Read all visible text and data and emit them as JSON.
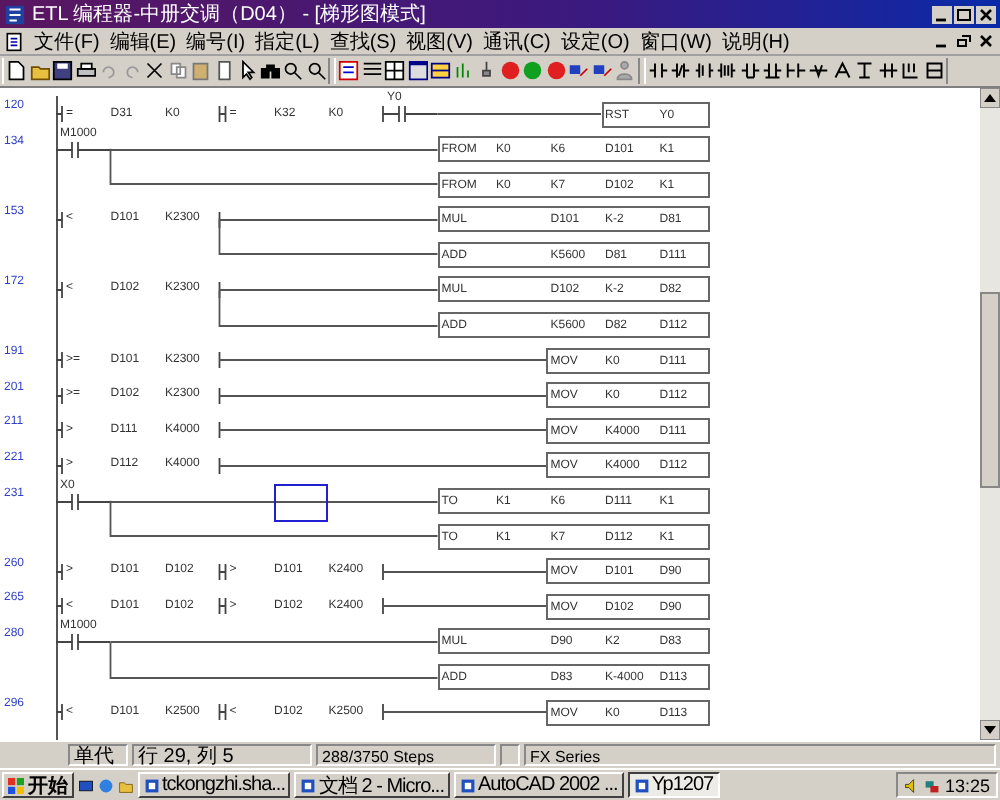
{
  "window": {
    "title": "ETL 编程器-中册交调（D04） - [梯形图模式]"
  },
  "menu": [
    "文件(F)",
    "编辑(E)",
    "编号(I)",
    "指定(L)",
    "查找(S)",
    "视图(V)",
    "通讯(C)",
    "设定(O)",
    "窗口(W)",
    "说明(H)"
  ],
  "ladder": {
    "rows": [
      {
        "kind": "rung",
        "step": "120",
        "cursor": false,
        "elements": [
          {
            "kind": "compare",
            "op": "=",
            "a": "D31",
            "b": "K0"
          },
          {
            "kind": "compare",
            "op": "=",
            "a": "K32",
            "b": "K0"
          },
          {
            "kind": "contact",
            "device": "Y0"
          }
        ],
        "output": {
          "op": "RST",
          "operands": [
            "Y0"
          ]
        }
      },
      {
        "kind": "rung",
        "step": "134",
        "cursor": false,
        "elements": [
          {
            "kind": "contact",
            "device": "M1000"
          }
        ],
        "output": {
          "op": "FROM",
          "operands": [
            "K0",
            "K6",
            "D101",
            "K1"
          ]
        }
      },
      {
        "kind": "branch",
        "cursor": false,
        "output": {
          "op": "FROM",
          "operands": [
            "K0",
            "K7",
            "D102",
            "K1"
          ]
        }
      },
      {
        "kind": "rung",
        "step": "153",
        "cursor": false,
        "elements": [
          {
            "kind": "compare",
            "op": "<",
            "a": "D101",
            "b": "K2300"
          }
        ],
        "output": {
          "op": "MUL",
          "operands": [
            "D101",
            "K-2",
            "D81"
          ]
        }
      },
      {
        "kind": "branch",
        "cursor": false,
        "output": {
          "op": "ADD",
          "operands": [
            "K5600",
            "D81",
            "D111"
          ]
        }
      },
      {
        "kind": "rung",
        "step": "172",
        "cursor": false,
        "elements": [
          {
            "kind": "compare",
            "op": "<",
            "a": "D102",
            "b": "K2300"
          }
        ],
        "output": {
          "op": "MUL",
          "operands": [
            "D102",
            "K-2",
            "D82"
          ]
        }
      },
      {
        "kind": "branch",
        "cursor": false,
        "output": {
          "op": "ADD",
          "operands": [
            "K5600",
            "D82",
            "D112"
          ]
        }
      },
      {
        "kind": "rung",
        "step": "191",
        "cursor": false,
        "elements": [
          {
            "kind": "compare",
            "op": ">=",
            "a": "D101",
            "b": "K2300"
          }
        ],
        "output": {
          "op": "MOV",
          "operands": [
            "K0",
            "D111"
          ]
        }
      },
      {
        "kind": "rung",
        "step": "201",
        "cursor": false,
        "elements": [
          {
            "kind": "compare",
            "op": ">=",
            "a": "D102",
            "b": "K2300"
          }
        ],
        "output": {
          "op": "MOV",
          "operands": [
            "K0",
            "D112"
          ]
        }
      },
      {
        "kind": "rung",
        "step": "211",
        "cursor": false,
        "elements": [
          {
            "kind": "compare",
            "op": ">",
            "a": "D111",
            "b": "K4000"
          }
        ],
        "output": {
          "op": "MOV",
          "operands": [
            "K4000",
            "D111"
          ]
        }
      },
      {
        "kind": "rung",
        "step": "221",
        "cursor": false,
        "elements": [
          {
            "kind": "compare",
            "op": ">",
            "a": "D112",
            "b": "K4000"
          }
        ],
        "output": {
          "op": "MOV",
          "operands": [
            "K4000",
            "D112"
          ]
        }
      },
      {
        "kind": "rung",
        "step": "231",
        "cursor": true,
        "elements": [
          {
            "kind": "contact",
            "device": "X0"
          }
        ],
        "output": {
          "op": "TO",
          "operands": [
            "K1",
            "K6",
            "D111",
            "K1"
          ]
        }
      },
      {
        "kind": "branch",
        "cursor": false,
        "output": {
          "op": "TO",
          "operands": [
            "K1",
            "K7",
            "D112",
            "K1"
          ]
        }
      },
      {
        "kind": "rung",
        "step": "260",
        "cursor": false,
        "elements": [
          {
            "kind": "compare",
            "op": ">",
            "a": "D101",
            "b": "D102"
          },
          {
            "kind": "compare",
            "op": ">",
            "a": "D101",
            "b": "K2400"
          }
        ],
        "output": {
          "op": "MOV",
          "operands": [
            "D101",
            "D90"
          ]
        }
      },
      {
        "kind": "rung",
        "step": "265",
        "cursor": false,
        "elements": [
          {
            "kind": "compare",
            "op": "<",
            "a": "D101",
            "b": "D102"
          },
          {
            "kind": "compare",
            "op": ">",
            "a": "D102",
            "b": "K2400"
          }
        ],
        "output": {
          "op": "MOV",
          "operands": [
            "D102",
            "D90"
          ]
        }
      },
      {
        "kind": "rung",
        "step": "280",
        "cursor": false,
        "elements": [
          {
            "kind": "contact",
            "device": "M1000"
          }
        ],
        "output": {
          "op": "MUL",
          "operands": [
            "D90",
            "K2",
            "D83"
          ]
        }
      },
      {
        "kind": "branch",
        "cursor": false,
        "output": {
          "op": "ADD",
          "operands": [
            "D83",
            "K-4000",
            "D113"
          ]
        }
      },
      {
        "kind": "rung",
        "step": "296",
        "cursor": false,
        "elements": [
          {
            "kind": "compare",
            "op": "<",
            "a": "D101",
            "b": "K2500"
          },
          {
            "kind": "compare",
            "op": "<",
            "a": "D102",
            "b": "K2500"
          }
        ],
        "output": {
          "op": "MOV",
          "operands": [
            "K0",
            "D113"
          ]
        }
      }
    ]
  },
  "status_bar": {
    "mode": "单代",
    "position": "行 29, 列 5",
    "steps": "288/3750 Steps",
    "series": "FX Series"
  },
  "taskbar": {
    "start": "开始",
    "tasks": [
      {
        "label": "tckongzhi.sha...",
        "selected": false
      },
      {
        "label": "文档 2 - Micro...",
        "selected": false
      },
      {
        "label": "AutoCAD 2002 ...",
        "selected": false
      },
      {
        "label": "Yp1207",
        "selected": true
      }
    ],
    "time": "13:25"
  }
}
